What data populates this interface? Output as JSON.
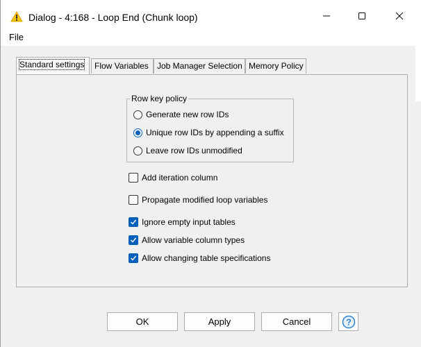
{
  "window": {
    "title": "Dialog - 4:168 - Loop End (Chunk loop)",
    "icon": "warning-triangle-icon"
  },
  "menu": {
    "items": [
      "File"
    ]
  },
  "tabs": [
    {
      "label": "Standard settings",
      "active": true
    },
    {
      "label": "Flow Variables",
      "active": false
    },
    {
      "label": "Job Manager Selection",
      "active": false
    },
    {
      "label": "Memory Policy",
      "active": false
    }
  ],
  "row_key_policy": {
    "title": "Row key policy",
    "options": [
      {
        "label": "Generate new row IDs",
        "checked": false
      },
      {
        "label": "Unique row IDs by appending a suffix",
        "checked": true
      },
      {
        "label": "Leave row IDs unmodified",
        "checked": false
      }
    ]
  },
  "checkboxes": [
    {
      "label": "Add iteration column",
      "checked": false
    },
    {
      "label": "Propagate modified loop variables",
      "checked": false
    },
    {
      "label": "Ignore empty input tables",
      "checked": true
    },
    {
      "label": "Allow variable column types",
      "checked": true
    },
    {
      "label": "Allow changing table specifications",
      "checked": true
    }
  ],
  "buttons": {
    "ok": "OK",
    "apply": "Apply",
    "cancel": "Cancel",
    "help_icon": "help-question-icon"
  },
  "colors": {
    "accent": "#005fb8",
    "title_icon": "#f5c400"
  }
}
